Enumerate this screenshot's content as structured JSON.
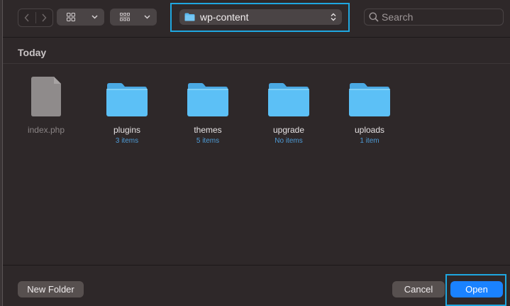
{
  "toolbar": {
    "back_icon": "chevron-left-icon",
    "forward_icon": "chevron-right-icon",
    "icon_view_icon": "grid-icon",
    "group_view_icon": "group-grid-icon",
    "path": {
      "label": "wp-content",
      "icon": "folder-icon"
    },
    "search": {
      "placeholder": "Search"
    }
  },
  "sidebar_section": {
    "title": "Today"
  },
  "files": [
    {
      "name": "index.php",
      "type": "document",
      "count": ""
    },
    {
      "name": "plugins",
      "type": "folder",
      "count": "3 items"
    },
    {
      "name": "themes",
      "type": "folder",
      "count": "5 items"
    },
    {
      "name": "upgrade",
      "type": "folder",
      "count": "No items"
    },
    {
      "name": "uploads",
      "type": "folder",
      "count": "1 item"
    }
  ],
  "footer": {
    "new_folder_label": "New Folder",
    "cancel_label": "Cancel",
    "open_label": "Open"
  },
  "colors": {
    "background": "#2e2829",
    "accent": "#1a82ff",
    "folder": "#5ac0f5",
    "highlight_outline": "#1fa7e0"
  }
}
